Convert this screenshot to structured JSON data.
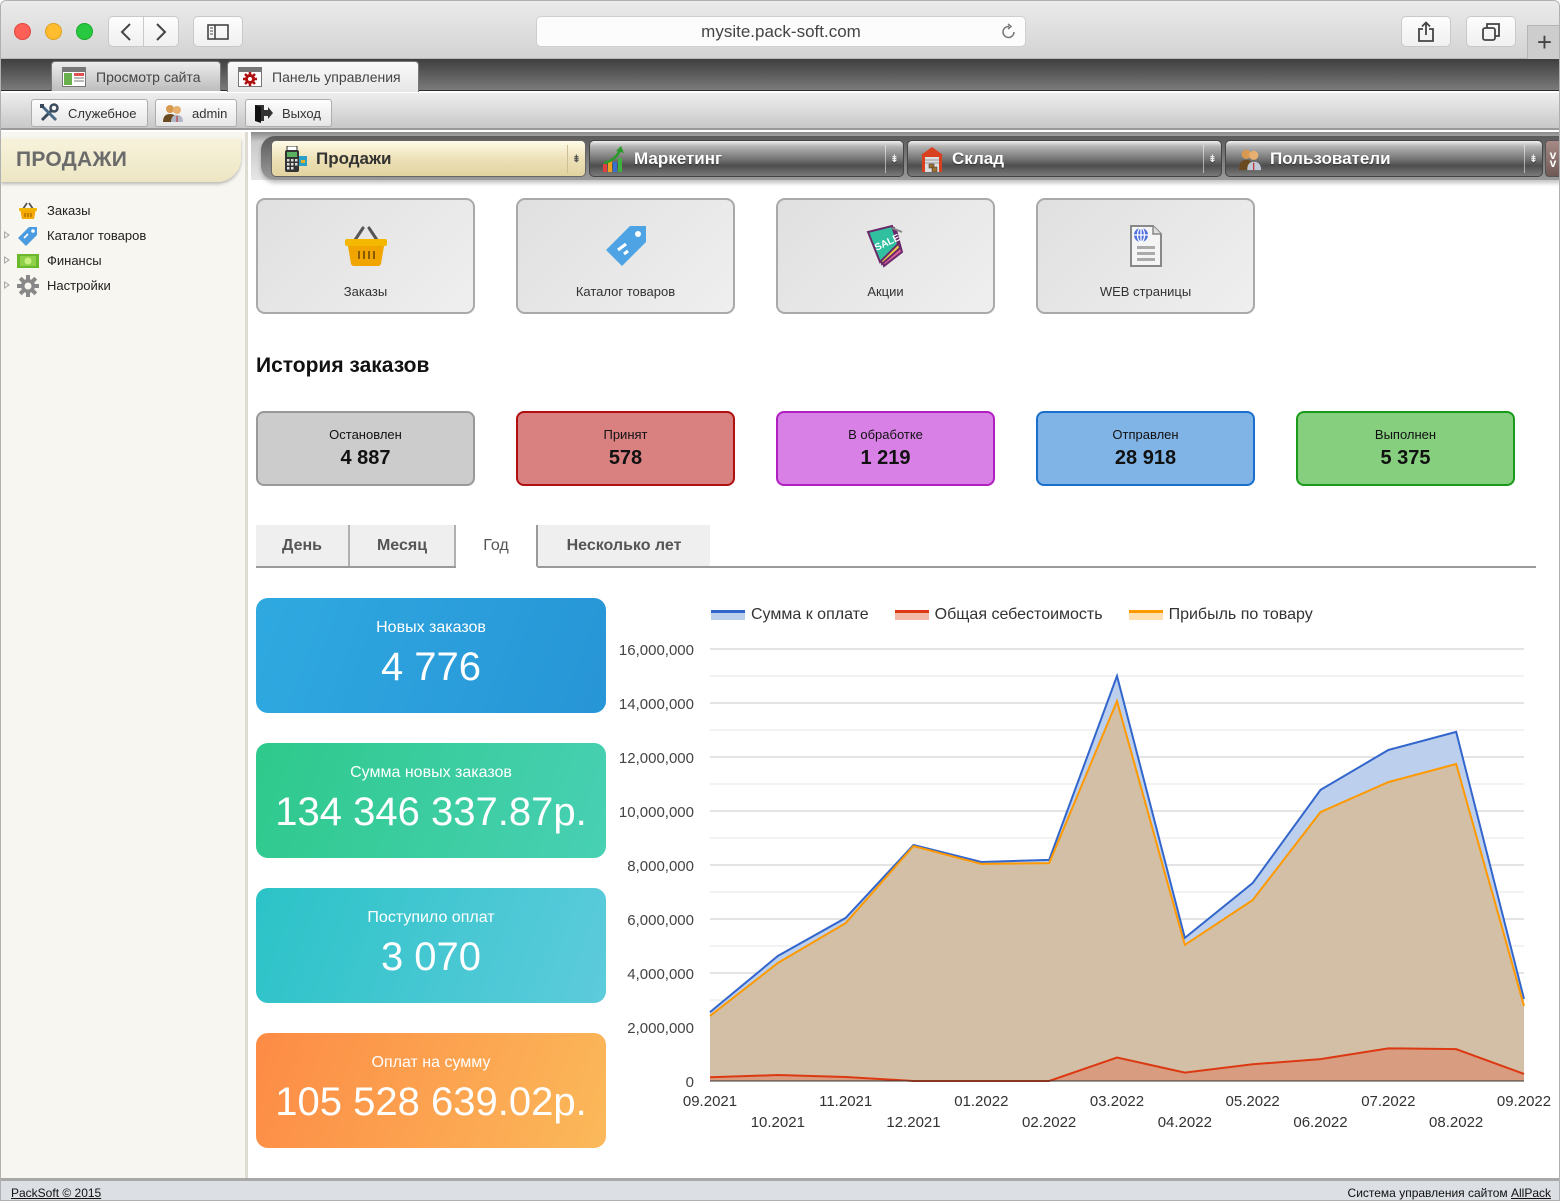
{
  "browser": {
    "url": "mysite.pack-soft.com",
    "tabs": [
      {
        "label": "Просмотр сайта",
        "icon": "site-preview-icon"
      },
      {
        "label": "Панель управления",
        "icon": "control-panel-gear-icon",
        "active": true
      }
    ]
  },
  "toolbar": {
    "service_label": "Служебное",
    "user_label": "admin",
    "logout_label": "Выход"
  },
  "sidebar": {
    "title": "ПРОДАЖИ",
    "items": [
      {
        "label": "Заказы",
        "icon": "basket-icon",
        "expandable": false
      },
      {
        "label": "Каталог товаров",
        "icon": "price-tag-icon",
        "expandable": true
      },
      {
        "label": "Финансы",
        "icon": "money-icon",
        "expandable": true
      },
      {
        "label": "Настройки",
        "icon": "gear-icon",
        "expandable": true
      }
    ]
  },
  "topnav": {
    "tabs": [
      {
        "label": "Продажи",
        "icon": "pos-terminal-icon",
        "active": true
      },
      {
        "label": "Маркетинг",
        "icon": "growth-chart-icon"
      },
      {
        "label": "Склад",
        "icon": "warehouse-icon"
      },
      {
        "label": "Пользователи",
        "icon": "users-icon"
      }
    ],
    "more_label": "»"
  },
  "tiles": [
    {
      "label": "Заказы",
      "icon": "basket-icon"
    },
    {
      "label": "Каталог товаров",
      "icon": "price-tag-icon"
    },
    {
      "label": "Акции",
      "icon": "sale-tag-icon"
    },
    {
      "label": "WEB страницы",
      "icon": "web-page-icon"
    }
  ],
  "history": {
    "title": "История заказов",
    "statuses": [
      {
        "label": "Остановлен",
        "value": "4 887",
        "bg": "#cccccc",
        "border": "#999999"
      },
      {
        "label": "Принят",
        "value": "578",
        "bg": "#d98080",
        "border": "#b01010"
      },
      {
        "label": "В обработке",
        "value": "1 219",
        "bg": "#d980e6",
        "border": "#b020c0"
      },
      {
        "label": "Отправлен",
        "value": "28 918",
        "bg": "#80b3e6",
        "border": "#1a6fcc"
      },
      {
        "label": "Выполнен",
        "value": "5 375",
        "bg": "#85cf7f",
        "border": "#1a9a1a"
      }
    ]
  },
  "period_tabs": [
    {
      "label": "День"
    },
    {
      "label": "Месяц"
    },
    {
      "label": "Год",
      "active": true
    },
    {
      "label": "Несколько лет"
    }
  ],
  "kpis": [
    {
      "label": "Новых заказов",
      "value": "4 776"
    },
    {
      "label": "Сумма новых заказов",
      "value": "134 346 337.87р."
    },
    {
      "label": "Поступило оплат",
      "value": "3 070"
    },
    {
      "label": "Оплат на сумму",
      "value": "105 528 639.02р."
    }
  ],
  "chart_data": {
    "type": "area",
    "title": "",
    "xlabel": "",
    "ylabel": "",
    "legend_position": "top",
    "grid": true,
    "ylim": [
      0,
      16000000
    ],
    "yticks": [
      0,
      2000000,
      4000000,
      6000000,
      8000000,
      10000000,
      12000000,
      14000000,
      16000000
    ],
    "ytick_labels": [
      "0",
      "2,000,000",
      "4,000,000",
      "6,000,000",
      "8,000,000",
      "10,000,000",
      "12,000,000",
      "14,000,000",
      "16,000,000"
    ],
    "categories": [
      "09.2021",
      "10.2021",
      "11.2021",
      "12.2021",
      "01.2022",
      "02.2022",
      "03.2022",
      "04.2022",
      "05.2022",
      "06.2022",
      "07.2022",
      "08.2022",
      "09.2022"
    ],
    "series": [
      {
        "name": "Сумма к оплате",
        "color": "#3366cc",
        "fill": "#bcd0ee",
        "values": [
          2550000,
          4630000,
          6040000,
          8740000,
          8110000,
          8190000,
          15000000,
          5300000,
          7330000,
          10780000,
          12260000,
          12930000,
          3040000
        ]
      },
      {
        "name": "Общая себестоимость",
        "color": "#dc3912",
        "fill": "#f1b9a8",
        "values": [
          140000,
          220000,
          150000,
          0,
          0,
          0,
          870000,
          310000,
          620000,
          810000,
          1210000,
          1180000,
          260000
        ]
      },
      {
        "name": "Прибыль по товару",
        "color": "#ff9900",
        "fill": "#ffe0b0",
        "values": [
          2410000,
          4370000,
          5850000,
          8700000,
          8040000,
          8070000,
          14070000,
          5040000,
          6700000,
          9960000,
          11070000,
          11740000,
          2780000
        ]
      }
    ]
  },
  "footer": {
    "left": "PackSoft © 2015",
    "right_text": "Система управления сайтом ",
    "right_link": "AllPack"
  }
}
